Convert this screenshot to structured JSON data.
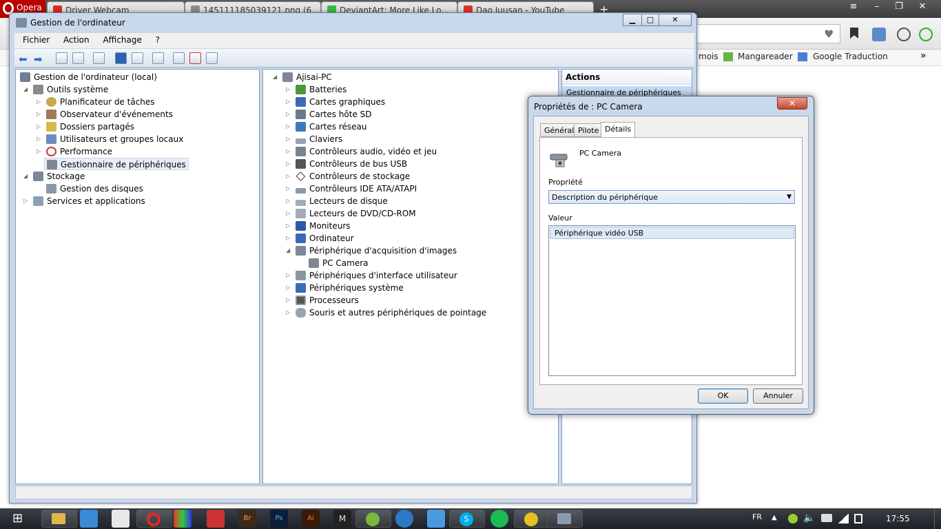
{
  "browser": {
    "app_label": "Opera",
    "tabs": [
      {
        "label": "Driver Webcam",
        "color": "#d52b1e"
      },
      {
        "label": "1451111850391​21.png (6...",
        "color": "#8a8a8a"
      },
      {
        "label": "DeviantArt: More Like Lo...",
        "color": "#2fbe3c"
      },
      {
        "label": "Dao Juusan - YouTube",
        "color": "#e52d27"
      }
    ],
    "bookmarks": [
      "mois",
      "Mangareader",
      "Google Traduction"
    ]
  },
  "window": {
    "title": "Gestion de l'ordinateur",
    "menu": [
      "Fichier",
      "Action",
      "Affichage",
      "?"
    ],
    "min_glyph": "▁",
    "max_glyph": "□",
    "close_glyph": "✕"
  },
  "tree": {
    "root": "Gestion de l'ordinateur (local)",
    "outils": "Outils système",
    "planificateur": "Planificateur de tâches",
    "observateur": "Observateur d'événements",
    "dossiers": "Dossiers partagés",
    "utilisateurs": "Utilisateurs et groupes locaux",
    "performance": "Performance",
    "gestionnaire": "Gestionnaire de périphériques",
    "stockage": "Stockage",
    "disques": "Gestion des disques",
    "services": "Services et applications"
  },
  "devices": {
    "root": "Ajisai-PC",
    "items": [
      "Batteries",
      "Cartes graphiques",
      "Cartes hôte SD",
      "Cartes réseau",
      "Claviers",
      "Contrôleurs audio, vidéo et jeu",
      "Contrôleurs de bus USB",
      "Contrôleurs de stockage",
      "Contrôleurs IDE ATA/ATAPI",
      "Lecteurs de disque",
      "Lecteurs de DVD/CD-ROM",
      "Moniteurs",
      "Ordinateur",
      "Périphérique d'acquisition d'images",
      "PC Camera",
      "Périphériques d'interface utilisateur",
      "Périphériques système",
      "Processeurs",
      "Souris et autres périphériques de pointage"
    ]
  },
  "actions": {
    "header": "Actions",
    "item": "Gestionnaire de périphériques"
  },
  "dialog": {
    "title": "Propriétés de : PC Camera",
    "tabs": [
      "Général",
      "Pilote",
      "Détails"
    ],
    "device_name": "PC Camera",
    "property_label": "Propriété",
    "property_value": "Description du périphérique",
    "value_label": "Valeur",
    "value_item": "Périphérique vidéo USB",
    "ok": "OK",
    "cancel": "Annuler"
  },
  "taskbar": {
    "lang": "FR",
    "time": "17:55"
  }
}
